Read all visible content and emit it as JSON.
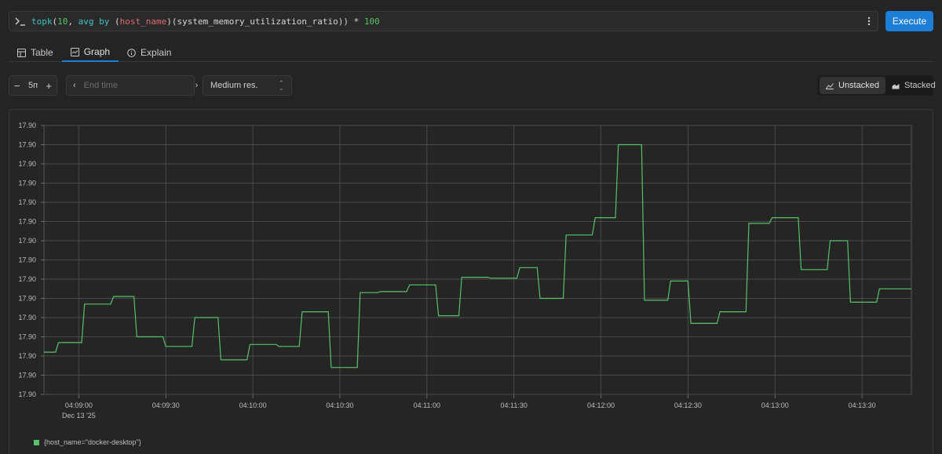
{
  "query": {
    "prompt_icon": "terminal-prompt-icon",
    "parts": [
      {
        "text": "topk",
        "cls": "q-fn"
      },
      {
        "text": "(",
        "cls": "q-op"
      },
      {
        "text": "10",
        "cls": "q-num"
      },
      {
        "text": ", ",
        "cls": "q-op"
      },
      {
        "text": "avg",
        "cls": "q-fn"
      },
      {
        "text": " ",
        "cls": "q-op"
      },
      {
        "text": "by",
        "cls": "q-fn"
      },
      {
        "text": " (",
        "cls": "q-op"
      },
      {
        "text": "host_name",
        "cls": "q-label"
      },
      {
        "text": ")(",
        "cls": "q-op"
      },
      {
        "text": "system_memory_utilization_ratio",
        "cls": "q-metric"
      },
      {
        "text": ")) * ",
        "cls": "q-op"
      },
      {
        "text": "100",
        "cls": "q-num"
      }
    ],
    "more_icon": "kebab-menu-icon",
    "execute_label": "Execute"
  },
  "tabs": [
    {
      "label": "Table",
      "icon": "table-icon",
      "active": false
    },
    {
      "label": "Graph",
      "icon": "graph-icon",
      "active": true
    },
    {
      "label": "Explain",
      "icon": "info-icon",
      "active": false
    }
  ],
  "controls": {
    "range_minus": "−",
    "range_value": "5m",
    "range_plus": "+",
    "end_time_placeholder": "End time",
    "resolution": "Medium res.",
    "unstacked_label": "Unstacked",
    "stacked_label": "Stacked",
    "stack_mode": "unstacked"
  },
  "colors": {
    "accent": "#1c7ed6",
    "series": "#56c26a"
  },
  "chart_data": {
    "type": "line",
    "y_tick_labels": [
      "17.90",
      "17.90",
      "17.90",
      "17.90",
      "17.90",
      "17.90",
      "17.90",
      "17.90",
      "17.90",
      "17.90",
      "17.90",
      "17.90",
      "17.90",
      "17.90",
      "17.90"
    ],
    "x_tick_labels": [
      "04:09:00",
      "04:09:30",
      "04:10:00",
      "04:10:30",
      "04:11:00",
      "04:11:30",
      "04:12:00",
      "04:12:30",
      "04:13:00",
      "04:13:30"
    ],
    "x_tick_seconds": [
      0,
      30,
      60,
      90,
      120,
      150,
      180,
      210,
      240,
      270
    ],
    "x_sublabel": "Dec 13 '25",
    "x_range_seconds": [
      -12,
      287
    ],
    "y_range_level": [
      0,
      14
    ],
    "grid": true,
    "series": [
      {
        "name": "{host_name=\"docker-desktop\"}",
        "step": true,
        "points": [
          [
            -12,
            2.2
          ],
          [
            -8,
            2.2
          ],
          [
            -7,
            2.7
          ],
          [
            1,
            2.7
          ],
          [
            2,
            4.7
          ],
          [
            11,
            4.7
          ],
          [
            12,
            5.1
          ],
          [
            19,
            5.1
          ],
          [
            20,
            3.0
          ],
          [
            29,
            3.0
          ],
          [
            30,
            2.5
          ],
          [
            39,
            2.5
          ],
          [
            40,
            4.0
          ],
          [
            48,
            4.0
          ],
          [
            49,
            1.8
          ],
          [
            58,
            1.8
          ],
          [
            59,
            2.6
          ],
          [
            68,
            2.6
          ],
          [
            69,
            2.5
          ],
          [
            76,
            2.5
          ],
          [
            77,
            4.3
          ],
          [
            86,
            4.3
          ],
          [
            87,
            1.4
          ],
          [
            96,
            1.4
          ],
          [
            97,
            5.3
          ],
          [
            103,
            5.3
          ],
          [
            104,
            5.35
          ],
          [
            113,
            5.35
          ],
          [
            114,
            5.7
          ],
          [
            123,
            5.7
          ],
          [
            124,
            4.1
          ],
          [
            131,
            4.1
          ],
          [
            132,
            6.1
          ],
          [
            141,
            6.1
          ],
          [
            142,
            6.05
          ],
          [
            151,
            6.05
          ],
          [
            152,
            6.6
          ],
          [
            158,
            6.6
          ],
          [
            159,
            5.0
          ],
          [
            167,
            5.0
          ],
          [
            168,
            8.3
          ],
          [
            177,
            8.3
          ],
          [
            178,
            9.2
          ],
          [
            185,
            9.2
          ],
          [
            186,
            13.0
          ],
          [
            194,
            13.0
          ],
          [
            195,
            4.9
          ],
          [
            203,
            4.9
          ],
          [
            204,
            5.9
          ],
          [
            210,
            5.9
          ],
          [
            211,
            3.7
          ],
          [
            220,
            3.7
          ],
          [
            221,
            4.3
          ],
          [
            230,
            4.3
          ],
          [
            231,
            8.9
          ],
          [
            238,
            8.9
          ],
          [
            239,
            9.2
          ],
          [
            248,
            9.2
          ],
          [
            249,
            6.5
          ],
          [
            258,
            6.5
          ],
          [
            259,
            8.0
          ],
          [
            265,
            8.0
          ],
          [
            266,
            4.8
          ],
          [
            275,
            4.8
          ],
          [
            276,
            5.5
          ],
          [
            287,
            5.5
          ]
        ]
      }
    ]
  },
  "legend": {
    "label": "{host_name=\"docker-desktop\"}"
  }
}
